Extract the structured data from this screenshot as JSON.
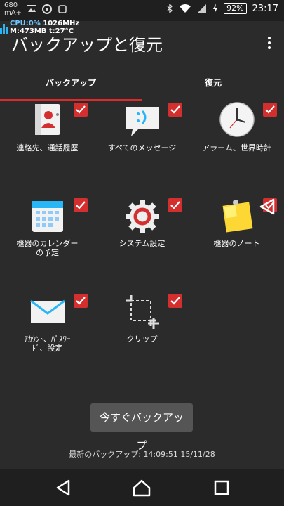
{
  "status_bar": {
    "ram_top": "680",
    "ram_unit": "mA+",
    "battery": "92%",
    "time": "23:17"
  },
  "overlay": {
    "cpu_label": "CPU:",
    "cpu_value": "0%",
    "cpu_freq": "1026MHz",
    "mem_label": "M:",
    "mem_value": "473MB",
    "temp": "t:27°C"
  },
  "app": {
    "title": "バックアップと復元"
  },
  "tabs": [
    {
      "label": "バックアップ",
      "selected": true
    },
    {
      "label": "復元",
      "selected": false
    }
  ],
  "items": [
    {
      "label": "連絡先、通話履歴",
      "icon": "contacts-icon",
      "checked": true
    },
    {
      "label": "すべてのメッセージ",
      "icon": "message-icon",
      "checked": true
    },
    {
      "label": "アラーム、世界時計",
      "icon": "clock-icon",
      "checked": true
    },
    {
      "label": "機器のカレンダーの予定",
      "icon": "calendar-icon",
      "checked": true
    },
    {
      "label": "システム設定",
      "icon": "gear-icon",
      "checked": true
    },
    {
      "label": "機器のノート",
      "icon": "note-icon",
      "checked": true
    },
    {
      "label": "ｱｶｳﾝﾄ、ﾊﾟｽﾜｰﾄﾞ、設定",
      "icon": "mail-icon",
      "checked": true
    },
    {
      "label": "クリップ",
      "icon": "crop-icon",
      "checked": true
    }
  ],
  "actions": {
    "backup_now": "今すぐバックアップ",
    "last_backup": "最新のバックアップ: 14:09:51 15/11/28"
  },
  "colors": {
    "accent": "#d32f2f",
    "background": "#2b2b2b"
  }
}
